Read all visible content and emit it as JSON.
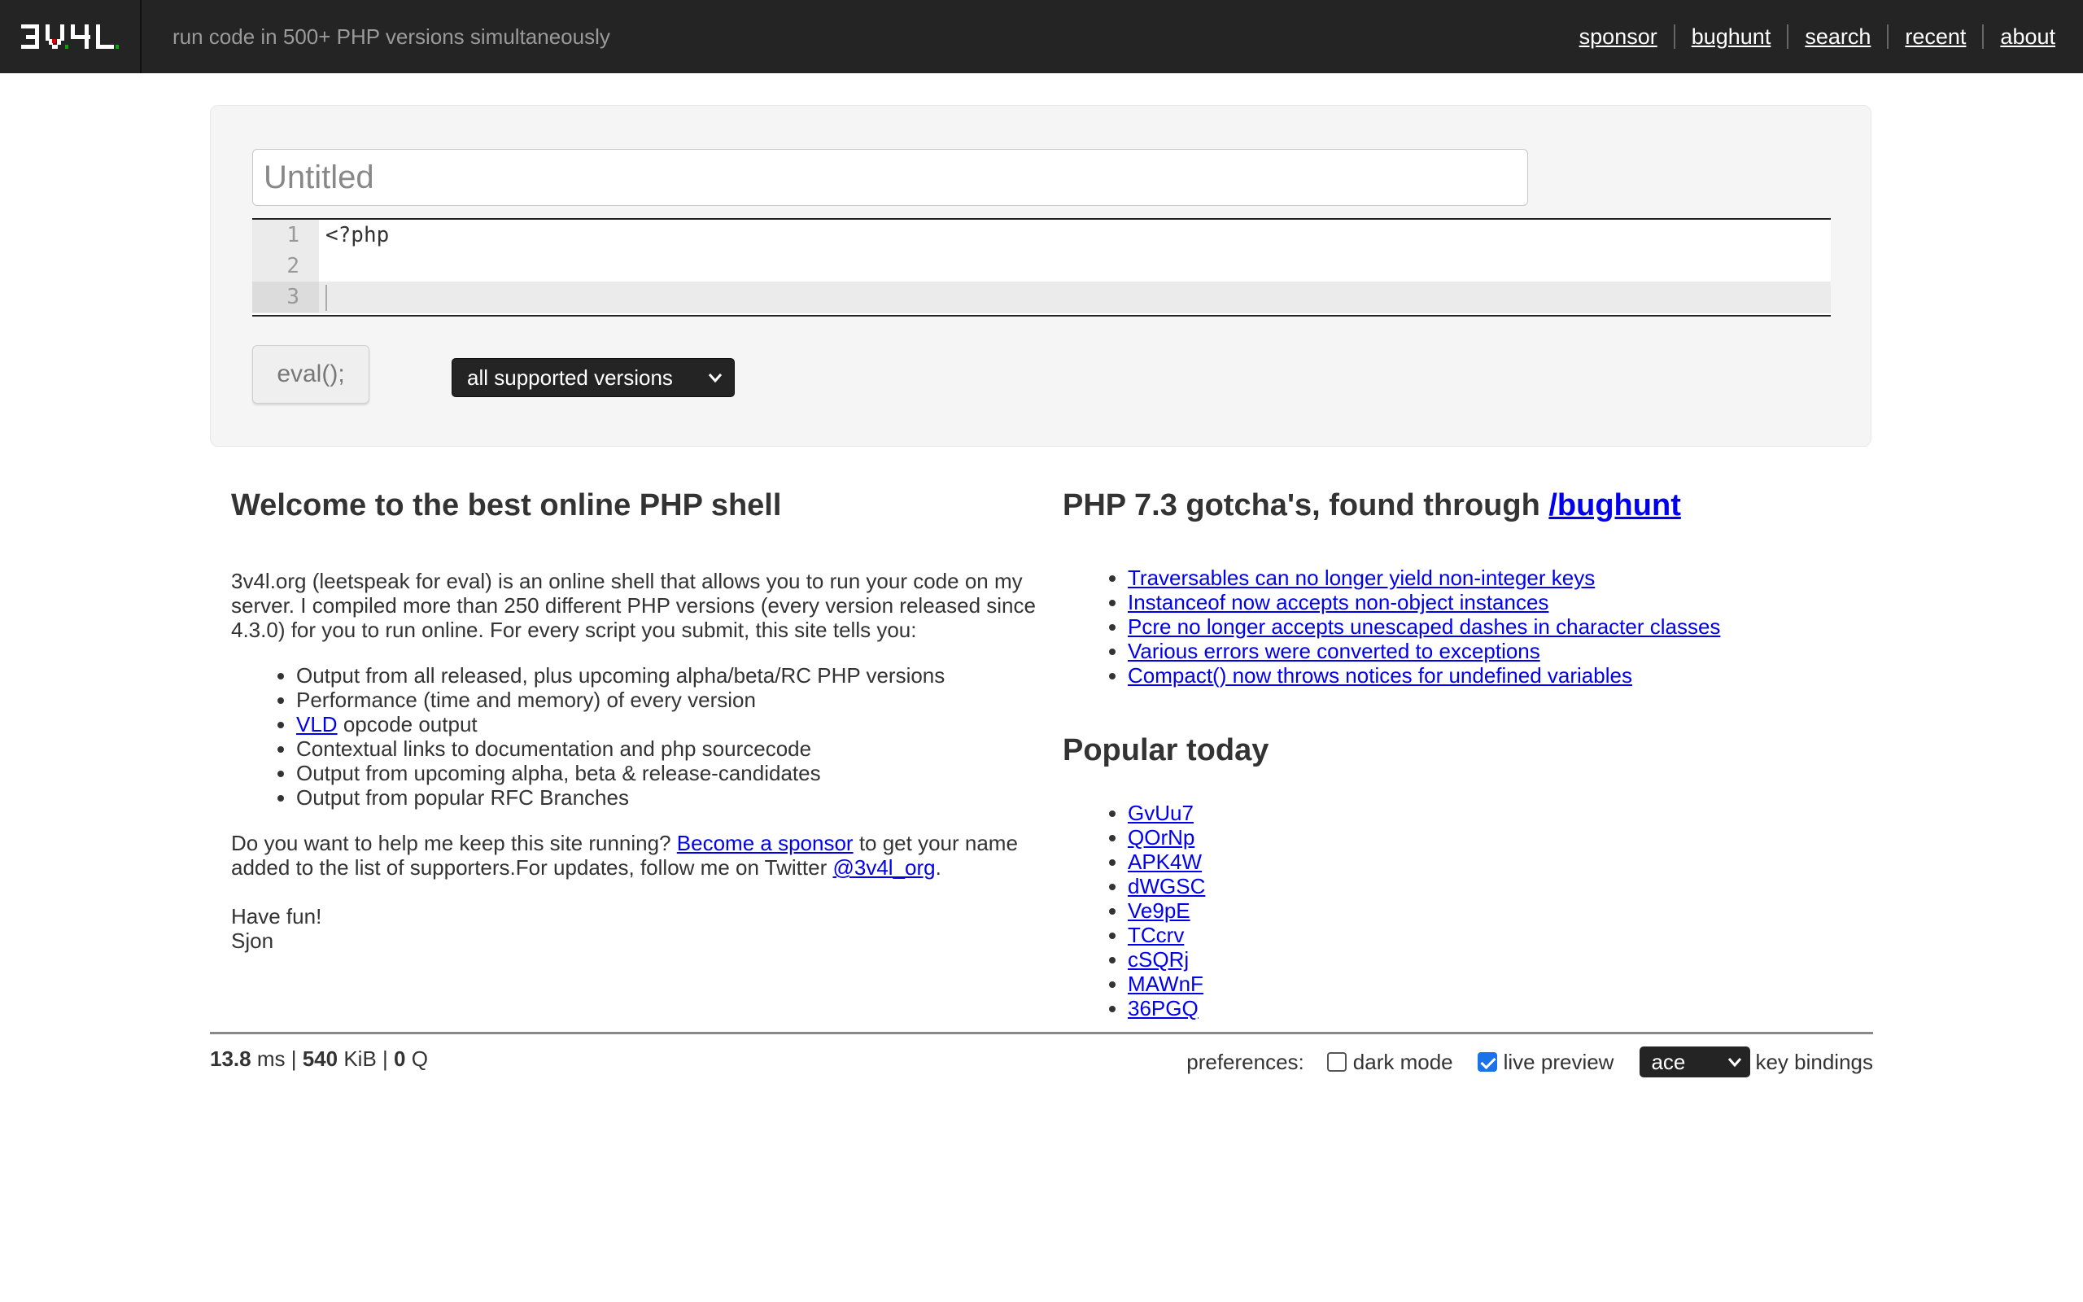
{
  "header": {
    "logo_text": "3V4L",
    "tagline": "run code in 500+ PHP versions simultaneously",
    "nav": [
      {
        "label": "sponsor"
      },
      {
        "label": "bughunt"
      },
      {
        "label": "search"
      },
      {
        "label": "recent"
      },
      {
        "label": "about"
      }
    ]
  },
  "editor": {
    "title_placeholder": "Untitled",
    "lines": [
      {
        "num": "1",
        "code": "<?php"
      },
      {
        "num": "2",
        "code": ""
      },
      {
        "num": "3",
        "code": ""
      }
    ],
    "eval_label": "eval();",
    "version_select": "all supported versions"
  },
  "welcome": {
    "title": "Welcome to the best online PHP shell",
    "intro": "3v4l.org (leetspeak for eval) is an online shell that allows you to run your code on my server. I compiled more than 250 different PHP versions (every version released since 4.3.0) for you to run online. For every script you submit, this site tells you:",
    "features": [
      "Output from all released, plus upcoming alpha/beta/RC PHP versions",
      "Performance (time and memory) of every version",
      "opcode output",
      "Contextual links to documentation and php sourcecode",
      "Output from upcoming alpha, beta & release-candidates",
      "Output from popular RFC Branches"
    ],
    "vld_link": "VLD",
    "sponsor_prefix": "Do you want to help me keep this site running?",
    "sponsor_link": "Become a sponsor",
    "sponsor_suffix": "to get your name added to the list of supporters.For updates, follow me on Twitter",
    "twitter_link": "@3v4l_org",
    "twitter_end": ".",
    "sign_off_1": "Have fun!",
    "sign_off_2": "Sjon"
  },
  "gotchas": {
    "title_prefix": "PHP 7.3 gotcha's, found through",
    "title_link": "/bughunt",
    "items": [
      "Traversables can no longer yield non-integer keys",
      "Instanceof now accepts non-object instances",
      "Pcre no longer accepts unescaped dashes in character classes",
      "Various errors were converted to exceptions",
      "Compact() now throws notices for undefined variables"
    ]
  },
  "popular": {
    "title": "Popular today",
    "items": [
      "GvUu7",
      "QOrNp",
      "APK4W",
      "dWGSC",
      "Ve9pE",
      "TCcrv",
      "cSQRj",
      "MAWnF",
      "36PGQ"
    ]
  },
  "footer": {
    "time_value": "13.8",
    "time_unit": "ms |",
    "mem_value": "540",
    "mem_unit": "KiB |",
    "q_value": "0",
    "q_unit": "Q",
    "prefs_label": "preferences:",
    "dark_mode_label": "dark mode",
    "dark_mode_checked": false,
    "live_preview_label": "live preview",
    "live_preview_checked": true,
    "keybinding_value": "ace",
    "keybinding_label": "key bindings"
  }
}
